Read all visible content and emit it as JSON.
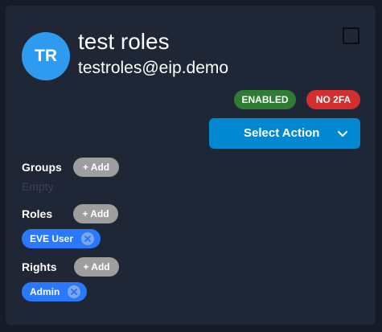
{
  "user": {
    "initials": "TR",
    "name": "test roles",
    "email": "testroles@eip.demo"
  },
  "status": {
    "enabled_label": "ENABLED",
    "twofa_label": "NO 2FA"
  },
  "actions": {
    "select_label": "Select Action"
  },
  "groups": {
    "label": "Groups",
    "add_label": "+ Add",
    "empty_text": "Empty"
  },
  "roles": {
    "label": "Roles",
    "add_label": "+ Add",
    "items": [
      {
        "label": "EVE User"
      }
    ]
  },
  "rights": {
    "label": "Rights",
    "add_label": "+ Add",
    "items": [
      {
        "label": "Admin"
      }
    ]
  },
  "colors": {
    "page_background": "#161b28",
    "card_background": "#1f2636",
    "avatar": "#2f9bf0",
    "enabled": "#2e7d32",
    "no_2fa": "#d32f2f",
    "select_action": "#0288d1",
    "add_button": "#9e9e9e",
    "chip": "#2979ff"
  },
  "icons": {
    "select_chevron": "chevron-down-icon",
    "chip_remove": "close-circle-icon",
    "select_box": "checkbox-icon"
  }
}
